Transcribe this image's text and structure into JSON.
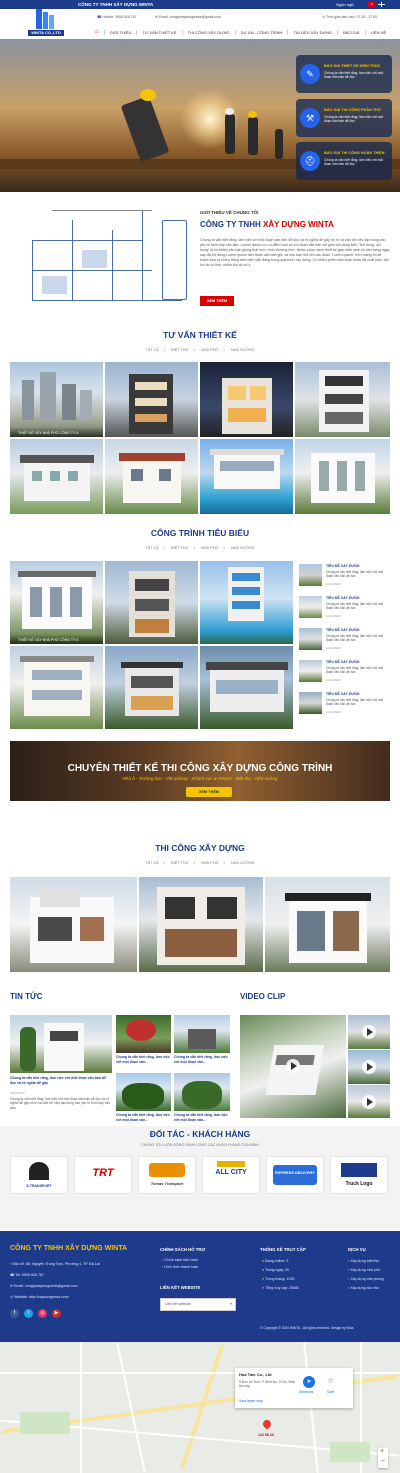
{
  "topbar": {
    "company": "CÔNG TY TNHH XÂY DỰNG WINTA",
    "language": "Ngôn ngữ"
  },
  "header": {
    "logo_text": "WINTA CO.,LTD",
    "hotline": "Hotline: 0906 826 787",
    "email": "Email: congtyxaydungwinta@gmail.com",
    "hours": "Thời gian làm việc: 07.00 - 17.00"
  },
  "nav": {
    "items": [
      "GIỚI THIỆU",
      "TƯ VẤN THIẾT KẾ",
      "THI CÔNG XÂY DỰNG",
      "DỰ ÁN - CÔNG TRÌNH",
      "TÀI LIỆU XÂY DỰNG",
      "BÁO GIÁ",
      "LIÊN HỆ"
    ]
  },
  "hero": {
    "features": [
      {
        "title": "BÁO GIÁ THIẾT KẾ KIẾN TRÚC",
        "desc": "Chúng ta vẫn biết rằng, làm việc với một đoạn văn bản dễ đọc"
      },
      {
        "title": "BÁO GIÁ THI CÔNG PHẦN THÔ",
        "desc": "Chúng ta vẫn biết rằng, làm việc với một đoạn văn bản dễ đọc"
      },
      {
        "title": "BÁO GIÁ THI CÔNG HOÀN THIỆN",
        "desc": "Chúng ta vẫn biết rằng, làm việc với một đoạn văn bản dễ đọc"
      }
    ]
  },
  "about": {
    "subtitle": "GIỚI THIỆU VỀ CHÚNG TÔI",
    "title_a": "CÔNG TY TNHH",
    "title_b": "XÂY DỰNG WINTA",
    "text": "Chúng ta vẫn biết rằng, làm việc với một đoạn văn bản dễ đọc và rõ nghĩa dễ gây rối trí và cản trở việc tập trung vào yếu tố trình bày văn bản. Lorem Ipsum có ưu điểm hơn so với đoạn văn bản chỉ gồm nội dung kiểu \"Nội dung, nội dung\" là nó khiến văn bản giống thật hơn, bình thường hơn. Nhiều phần mềm thiết kế giao diện web và dàn trang ngày nay đã sử dụng Lorem Ipsum làm đoạn văn bản giả, và nếu bạn thử tìm các đoạn \"Lorem ipsum\" trên mạng thì sẽ khám phá ra nhiều trang web hiện vẫn đang trong quá trình xây dựng. Có nhiều phiên bản khác nhau đã xuất hiện, đôi khi do vô tình, nhiều khi do cố ý",
    "button": "XEM THÊM"
  },
  "design": {
    "title": "TƯ VẤN THIẾT KẾ",
    "tabs": [
      "TẤT CẢ",
      "BIỆT THỰ",
      "NHÀ PHỐ",
      "NHÀ XƯỞNG"
    ],
    "caption": "THIẾT KẾ XÂY NHÀ PHỐ CÔNG TY A"
  },
  "projects": {
    "title": "CÔNG TRÌNH TIÊU BIỂU",
    "tabs": [
      "TẤT CẢ",
      "BIỆT THỰ",
      "NHÀ PHỐ",
      "NHÀ XƯỞNG"
    ],
    "caption": "THIẾT KẾ XÂY NHÀ PHỐ CÔNG TY A",
    "side": [
      {
        "title": "TIÊU ĐỀ XÂY DỰNG",
        "desc": "Chúng ta vẫn biết rằng, làm việc với một đoạn văn bản dễ đọc",
        "date": "10/10/2020"
      },
      {
        "title": "TIÊU ĐỀ XÂY DỰNG",
        "desc": "Chúng ta vẫn biết rằng, làm việc với một đoạn văn bản dễ đọc",
        "date": "10/10/2020"
      },
      {
        "title": "TIÊU ĐỀ XÂY DỰNG",
        "desc": "Chúng ta vẫn biết rằng, làm việc với một đoạn văn bản dễ đọc",
        "date": "10/10/2020"
      },
      {
        "title": "TIÊU ĐỀ XÂY DỰNG",
        "desc": "Chúng ta vẫn biết rằng, làm việc với một đoạn văn bản dễ đọc",
        "date": "10/10/2020"
      },
      {
        "title": "TIÊU ĐỀ XÂY DỰNG",
        "desc": "Chúng ta vẫn biết rằng, làm việc với một đoạn văn bản dễ đọc",
        "date": "10/10/2020"
      }
    ]
  },
  "banner": {
    "title": "CHUYÊN THIẾT KẾ THI CÔNG XÂY DỰNG CÔNG TRÌNH",
    "subtitle": "Nhà ở - Trường học - Văn phòng - Khách sạn & Resort - Biệt thự - Nhà xưởng",
    "button": "XEM THÊM"
  },
  "construction": {
    "title": "THI CÔNG XÂY DỰNG",
    "tabs": [
      "TẤT CẢ",
      "BIỆT THỰ",
      "NHÀ PHỐ",
      "NHÀ XƯỞNG"
    ]
  },
  "news": {
    "title": "TIN TỨC",
    "main_title": "Chúng ta vẫn biết rằng, làm việc với một đoạn văn bản dễ đọc và rõ nghĩa dễ gây",
    "main_date": "10/11/2019",
    "main_desc": "Chúng ta vẫn biết rằng, làm việc với một đoạn văn bản dễ đọc và rõ nghĩa dễ gây rối trí và cản trở việc tập trung vào yếu tố trình bày văn bản.",
    "small_title": "Chúng ta vẫn biết rằng, làm việc với một đoạn văn..."
  },
  "video": {
    "title": "VIDEO CLIP"
  },
  "partners": {
    "title": "ĐỐI TÁC - KHÁCH HÀNG",
    "subtitle": "CHÚNG TÔI LUÔN ĐỒNG HÀNH CÙNG CÁC KHÁCH HÀNG CỦA MÌNH",
    "logos": [
      "S-TRANSPORT",
      "TRT",
      "Tomas Transport",
      "ALL CITY",
      "EXPRESS DELIVERY",
      "Truck Logo"
    ]
  },
  "footer": {
    "company": "CÔNG TY TNHH XÂY DỰNG WINTA",
    "address": "Địa chỉ: 58, Nguyễn Trung Trực, Phường 4, TP. Đà Lạt",
    "tel": "Tel: 0906 826 787",
    "email": "Email: congtyxaydungwinta@gmail.com",
    "website": "Website: http://xaydungwinta.com/",
    "policy_title": "CHÍNH SÁCH HỖ TRỢ",
    "policy": [
      "Chính sách bảo hành",
      "Hình thức thanh toán"
    ],
    "links_title": "LIÊN KẾT WEBSITE",
    "select_placeholder": "Liên kết website",
    "stats_title": "THỐNG KÊ TRUY CẬP",
    "stats": [
      "Đang online: 5",
      "Trong ngày: 20",
      "Trong tháng: 1235",
      "Tổng truy cập: 20680"
    ],
    "services_title": "DỊCH VỤ",
    "services": [
      "Xây dựng biệt thự",
      "Xây dựng nhà phố",
      "Xây dựng văn phòng",
      "Xây dựng tòa nhà"
    ],
    "copyright": "© Copyright © 2020 WINTA . All rights reserved. Design by Nina"
  },
  "map": {
    "place": "Hoa Tam Co., Ltd",
    "addr": "9 Đức lợi Tích, P. Bình An, Dĩ An, Bình Dương",
    "directions": "Directions",
    "save": "Save",
    "larger": "View larger map",
    "pin": "123 56 44"
  }
}
